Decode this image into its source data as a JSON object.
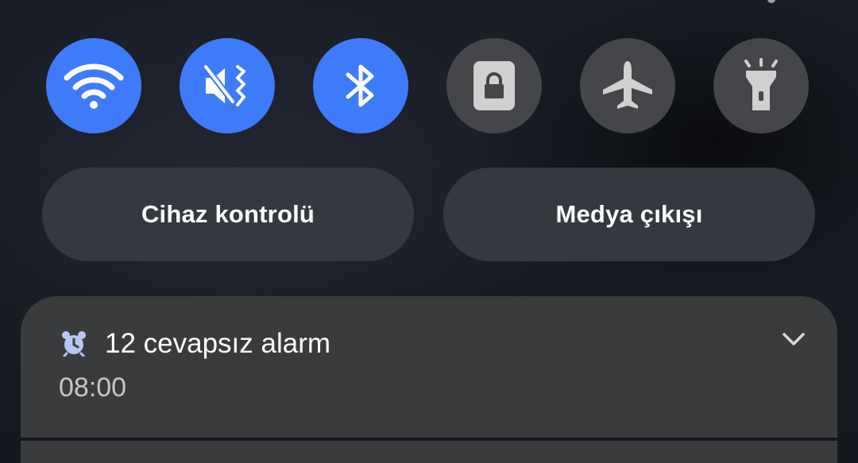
{
  "quick_tiles": [
    {
      "icon": "wifi-icon",
      "state": "on"
    },
    {
      "icon": "sound-off-vibrate-icon",
      "state": "on"
    },
    {
      "icon": "bluetooth-icon",
      "state": "on"
    },
    {
      "icon": "portrait-lock-icon",
      "state": "off"
    },
    {
      "icon": "airplane-icon",
      "state": "off"
    },
    {
      "icon": "flashlight-icon",
      "state": "off"
    }
  ],
  "buttons": {
    "device_control": "Cihaz kontrolü",
    "media_output": "Medya çıkışı"
  },
  "notification": {
    "icon": "alarm-clock-icon",
    "title": "12 cevapsız alarm",
    "time": "08:00",
    "expand_icon": "chevron-down-icon"
  },
  "colors": {
    "tile_on": "#3e7bfa",
    "tile_off": "#444649",
    "pill_bg": "#34383f",
    "card_bg": "#3a3b3d"
  }
}
